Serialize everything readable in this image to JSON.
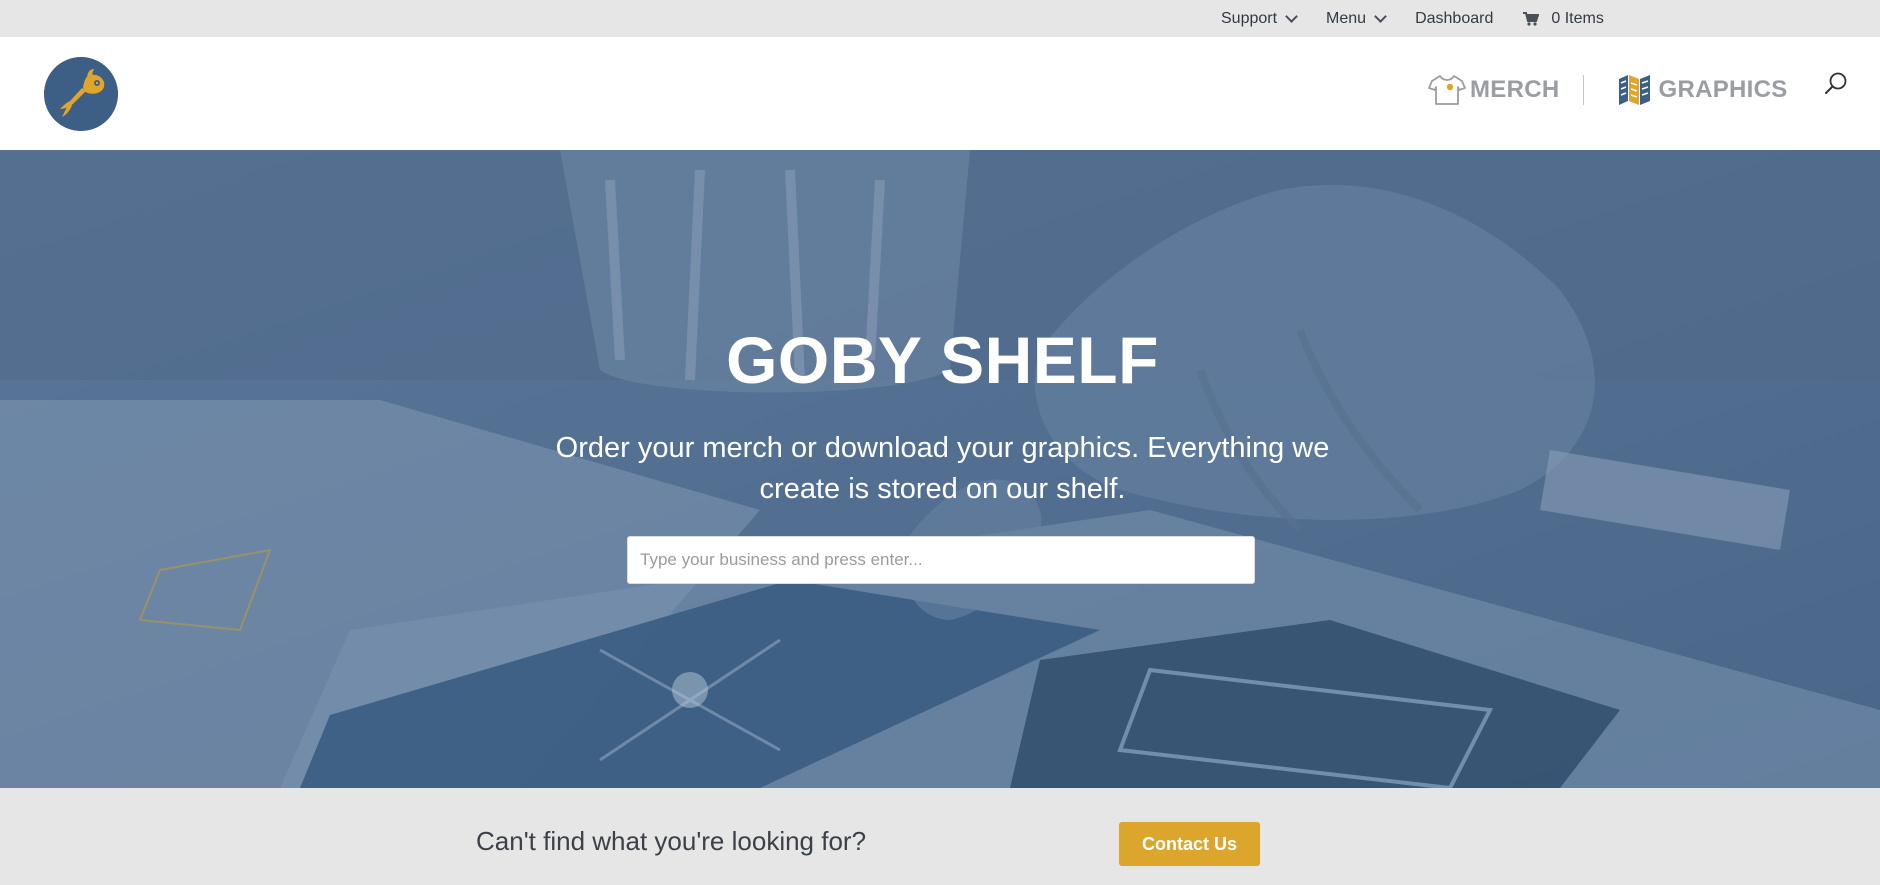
{
  "topbar": {
    "support_label": "Support",
    "menu_label": "Menu",
    "dashboard_label": "Dashboard",
    "cart_label": "0 Items"
  },
  "header": {
    "merch_label": "MERCH",
    "graphics_label": "GRAPHICS"
  },
  "hero": {
    "title": "GOBY SHELF",
    "subtitle": "Order your merch or download your graphics. Everything we create is stored on our shelf.",
    "search_placeholder": "Type your business and press enter..."
  },
  "cta": {
    "text": "Can't find what you're looking for?",
    "button_label": "Contact Us"
  },
  "colors": {
    "brand_blue": "#3d5f86",
    "accent_gold": "#dba62b",
    "topbar_bg": "#e6e6e6"
  },
  "icons": [
    "chevron-down-icon",
    "cart-icon",
    "fish-logo",
    "tshirt-icon",
    "map-icon",
    "search-icon"
  ]
}
